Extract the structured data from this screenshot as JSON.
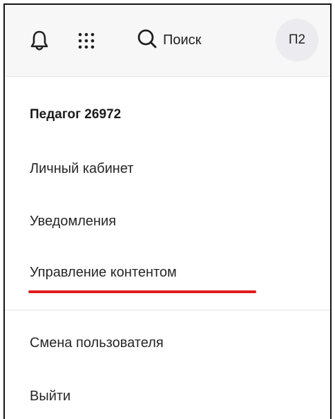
{
  "header": {
    "bell_icon": "bell-icon",
    "apps_icon": "apps-grid-icon",
    "search_icon": "search-icon",
    "search_label": "Поиск",
    "avatar_initials": "П2"
  },
  "menu": {
    "user_name": "Педагог 26972",
    "items": [
      {
        "label": "Личный кабинет"
      },
      {
        "label": "Уведомления"
      },
      {
        "label": "Управление контентом"
      },
      {
        "label": "Смена пользователя"
      },
      {
        "label": "Выйти"
      }
    ]
  },
  "colors": {
    "highlight_underline": "#e31b1b",
    "header_bg": "#f7f7f8",
    "avatar_bg": "#ececf0"
  }
}
